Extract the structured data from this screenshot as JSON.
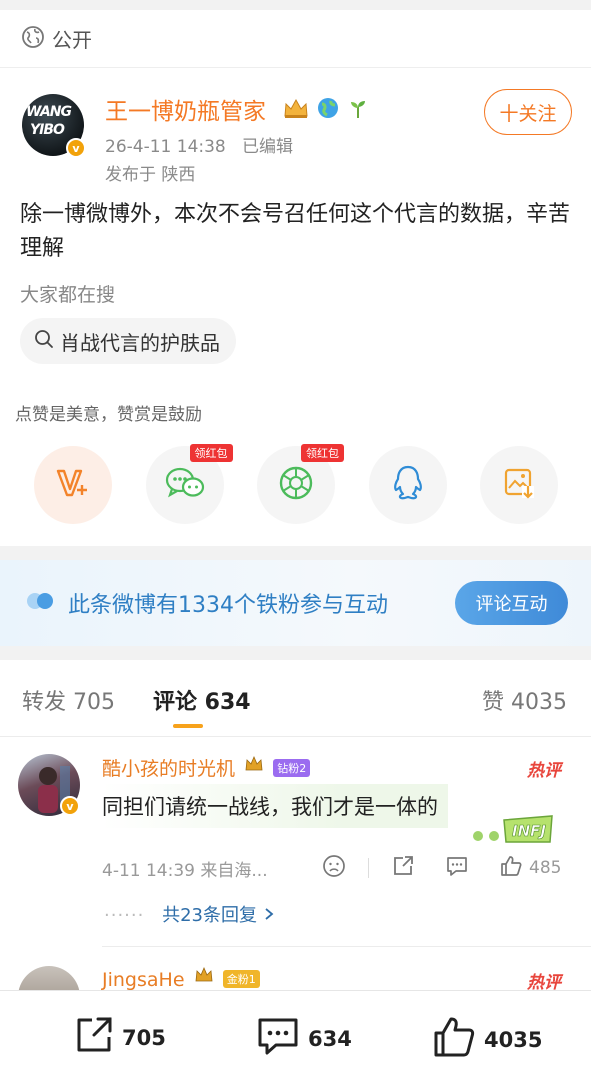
{
  "visibility": {
    "label": "公开",
    "icon": "globe-icon"
  },
  "post": {
    "author": "王一博奶瓶管家",
    "avatar_text": [
      "WANG",
      "YIBO"
    ],
    "time": "26-4-11 14:38",
    "edited": "已编辑",
    "location": "发布于 陕西",
    "follow_label": "十关注",
    "content": "除一博微博外，本次不会号召任何这个代言的数据，辛苦理解",
    "search_title": "大家都在搜",
    "search_chip": "肖战代言的护肤品",
    "like_hint": "点赞是美意，赞赏是鼓励",
    "share_tag": "领红包",
    "share_buttons": [
      "reward-v-icon",
      "wechat-icon",
      "moments-icon",
      "qq-icon",
      "save-image-icon"
    ]
  },
  "fan_banner": {
    "text": "此条微博有1334个铁粉参与互动",
    "button": "评论互动"
  },
  "tabs": {
    "repost": "转发 705",
    "comment": "评论 634",
    "like": "赞 4035"
  },
  "comments": [
    {
      "name": "酷小孩的时光机",
      "fan_badge": "钻粉2",
      "hot": "热评",
      "text": "同担们请统一战线，我们才是一体的",
      "meta": "4-11 14:39 来自海...",
      "likes": "485",
      "replies": "共23条回复",
      "reply_dots": "······"
    },
    {
      "name": "JingsaHe",
      "fan_badge": "金粉1",
      "hot": "热评"
    }
  ],
  "bottom_bar": {
    "repost": "705",
    "comment": "634",
    "like": "4035"
  },
  "colors": {
    "accent_orange": "#f47925",
    "link_blue": "#2f7fc4",
    "hot_red": "#e8453c"
  }
}
